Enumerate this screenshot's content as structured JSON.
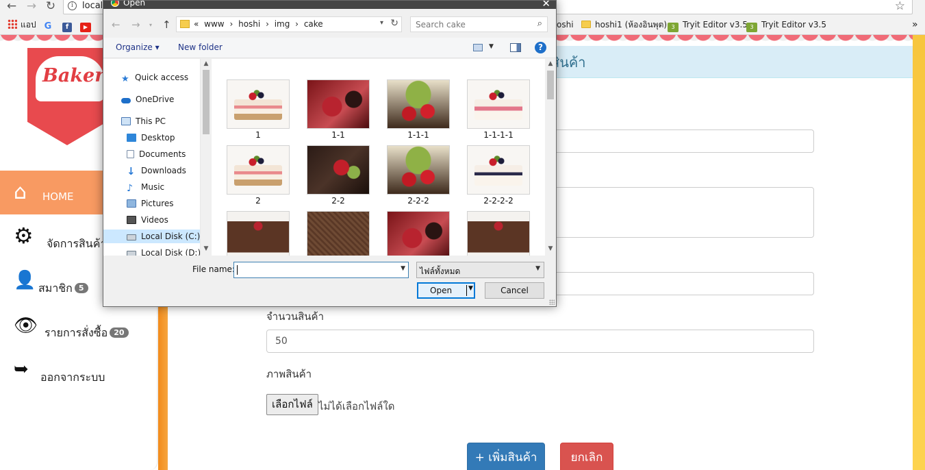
{
  "browser": {
    "address_text": "local",
    "bookmarks": [
      {
        "label": "แอป",
        "icon": "apps-grid-icon"
      },
      {
        "label": "",
        "icon": "google-icon"
      },
      {
        "label": "",
        "icon": "facebook-icon"
      },
      {
        "label": "",
        "icon": "youtube-icon"
      },
      {
        "label": "oshi",
        "icon": "folder-icon"
      },
      {
        "label": "hoshi1 (ห้องอินพุต)",
        "icon": "folder-icon"
      },
      {
        "label": "Tryit Editor v3.5",
        "icon": "tryit-icon"
      },
      {
        "label": "Tryit Editor v3.5",
        "icon": "tryit-icon"
      }
    ],
    "more_bookmarks": "»"
  },
  "page": {
    "logo_text": "Bakery",
    "header_title": "สินค้า",
    "menu": {
      "home": "HOME",
      "products": "จัดการสินค้า",
      "members": "สมาชิก",
      "members_count": "5",
      "orders": "รายการสั่งซื้อ",
      "orders_count": "20",
      "logout": "ออกจากระบบ"
    },
    "form": {
      "quantity_label": "จำนวนสินค้า",
      "quantity_value": "50",
      "image_label": "ภาพสินค้า",
      "choose_file": "เลือกไฟล์",
      "no_file": "ไม่ได้เลือกไฟล์ใด",
      "submit": "+ เพิ่มสินค้า",
      "cancel": "ยกเลิก"
    },
    "colors": {
      "home_bg": "#f89a62",
      "primary": "#337ab7",
      "danger": "#d9534f",
      "header_bg": "#d9edf7"
    }
  },
  "dialog": {
    "title": "Open",
    "path": [
      "«",
      "www",
      "›",
      "hoshi",
      "›",
      "img",
      "›",
      "cake"
    ],
    "search_placeholder": "Search cake",
    "organize": "Organize ▾",
    "new_folder": "New folder",
    "nav": [
      "Quick access",
      "OneDrive",
      "This PC",
      "Desktop",
      "Documents",
      "Downloads",
      "Music",
      "Pictures",
      "Videos",
      "Local Disk (C:)",
      "Local Disk (D:)"
    ],
    "files": [
      "1",
      "1-1",
      "1-1-1",
      "1-1-1-1",
      "2",
      "2-2",
      "2-2-2",
      "2-2-2-2",
      "",
      "",
      "",
      ""
    ],
    "file_name_label": "File name:",
    "file_name_value": "",
    "file_type": "ไฟล์ทั้งหมด",
    "open_button": "Open",
    "cancel_button": "Cancel"
  }
}
